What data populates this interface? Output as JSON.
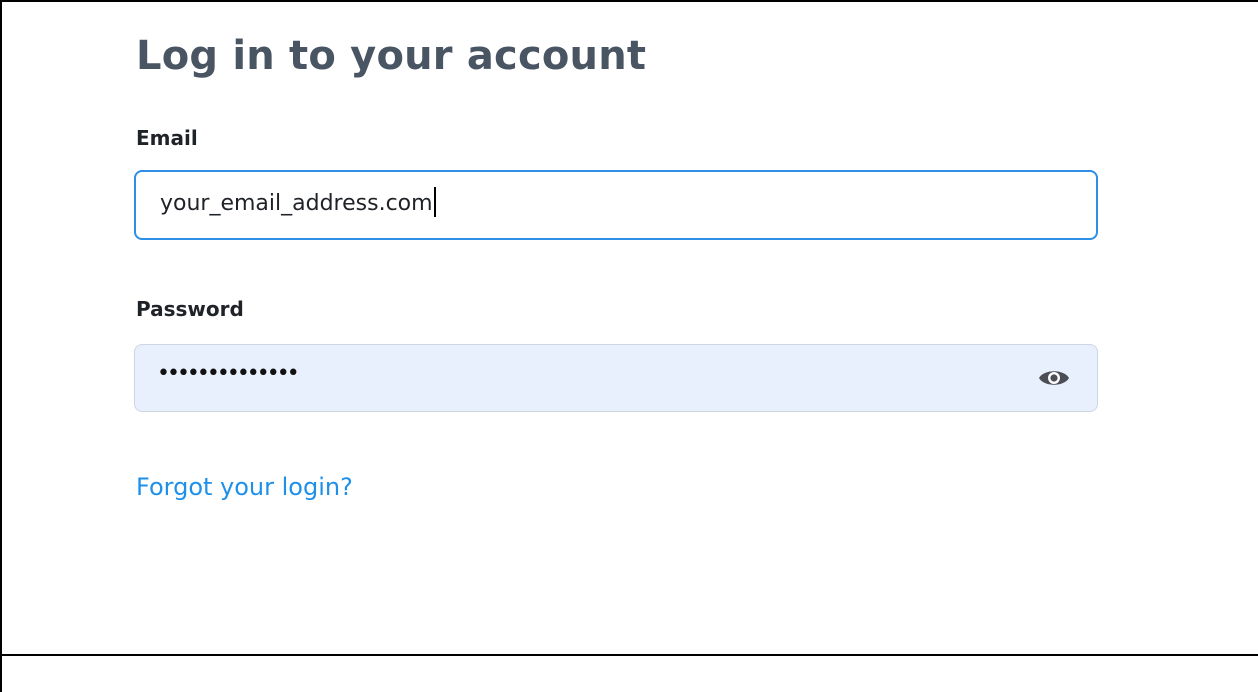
{
  "login": {
    "title": "Log in to your account",
    "email_label": "Email",
    "email_value": "your_email_address.com",
    "password_label": "Password",
    "password_mask": "••••••••••••••",
    "show_password_icon": "eye-icon",
    "forgot_link": "Forgot your login?"
  },
  "colors": {
    "title": "#4a5563",
    "focus_border": "#2f8fe6",
    "autofill_bg": "#e8effd",
    "link": "#1e90ea"
  }
}
